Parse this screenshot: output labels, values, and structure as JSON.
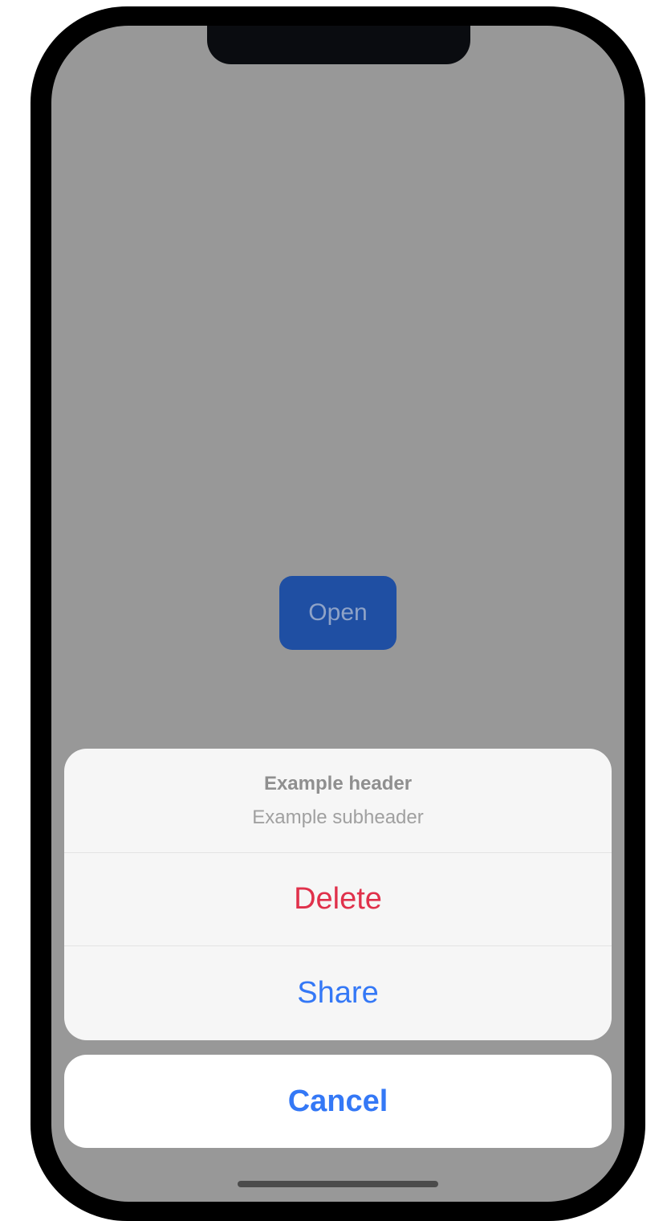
{
  "screen": {
    "open_button_label": "Open"
  },
  "action_sheet": {
    "header": "Example header",
    "subheader": "Example subheader",
    "actions": [
      {
        "label": "Delete",
        "color": "#e0314b"
      },
      {
        "label": "Share",
        "color": "#3478f6"
      }
    ],
    "cancel_label": "Cancel"
  },
  "colors": {
    "overlay": "#989898",
    "primary_button": "#1f4fa3",
    "accent": "#3478f6",
    "destructive": "#e0314b"
  }
}
